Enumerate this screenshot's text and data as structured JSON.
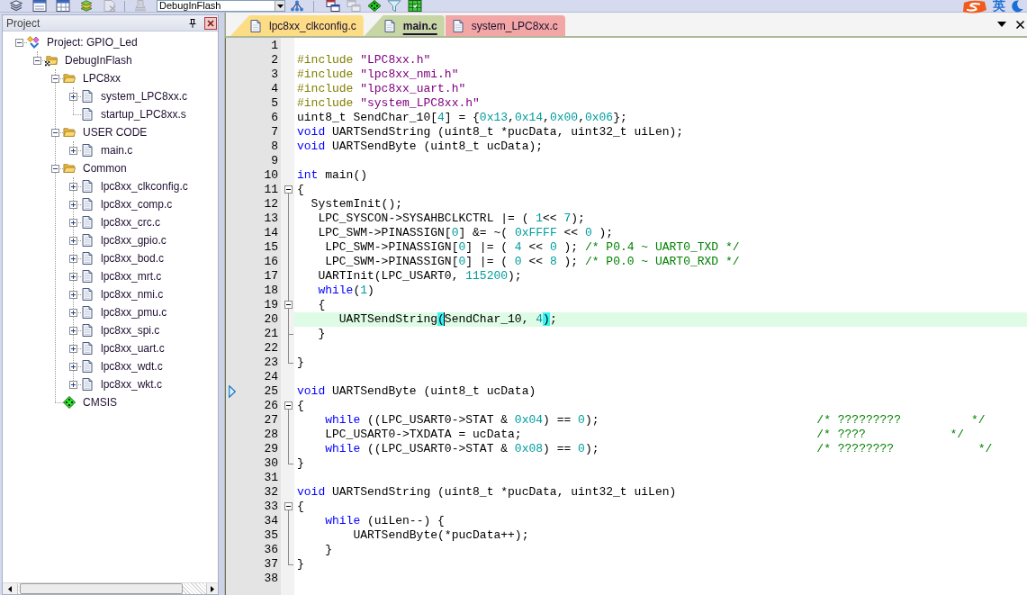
{
  "toolbar": {
    "items": [
      {
        "kind": "button",
        "disabled": false
      },
      {
        "kind": "button",
        "disabled": false
      },
      {
        "kind": "button",
        "disabled": false
      },
      {
        "kind": "button",
        "disabled": false
      },
      {
        "kind": "button",
        "disabled": true
      },
      {
        "kind": "separator"
      },
      {
        "kind": "button",
        "disabled": true
      },
      {
        "kind": "select",
        "value": "DebugInFlash"
      },
      {
        "kind": "button",
        "disabled": false
      },
      {
        "kind": "separator"
      },
      {
        "kind": "button",
        "disabled": false
      },
      {
        "kind": "button",
        "disabled": true
      },
      {
        "kind": "button",
        "disabled": false
      },
      {
        "kind": "button",
        "disabled": false
      },
      {
        "kind": "button",
        "disabled": false
      }
    ]
  },
  "input_method": {
    "mode": "英"
  },
  "project_panel": {
    "title": "Project",
    "tree": [
      {
        "label": "Project: GPIO_Led",
        "kind": "project",
        "expanded": true,
        "children": [
          {
            "label": "DebugInFlash",
            "kind": "target",
            "expanded": true,
            "children": [
              {
                "label": "LPC8xx",
                "kind": "folder",
                "expanded": true,
                "children": [
                  {
                    "label": "system_LPC8xx.c",
                    "kind": "file",
                    "expanded": false
                  },
                  {
                    "label": "startup_LPC8xx.s",
                    "kind": "file"
                  }
                ]
              },
              {
                "label": "USER CODE",
                "kind": "folder",
                "expanded": true,
                "children": [
                  {
                    "label": "main.c",
                    "kind": "file",
                    "expanded": false
                  }
                ]
              },
              {
                "label": "Common",
                "kind": "folder",
                "expanded": true,
                "children": [
                  {
                    "label": "lpc8xx_clkconfig.c",
                    "kind": "file",
                    "expanded": false
                  },
                  {
                    "label": "lpc8xx_comp.c",
                    "kind": "file",
                    "expanded": false
                  },
                  {
                    "label": "lpc8xx_crc.c",
                    "kind": "file",
                    "expanded": false
                  },
                  {
                    "label": "lpc8xx_gpio.c",
                    "kind": "file",
                    "expanded": false
                  },
                  {
                    "label": "lpc8xx_bod.c",
                    "kind": "file",
                    "expanded": false
                  },
                  {
                    "label": "lpc8xx_mrt.c",
                    "kind": "file",
                    "expanded": false
                  },
                  {
                    "label": "lpc8xx_nmi.c",
                    "kind": "file",
                    "expanded": false
                  },
                  {
                    "label": "lpc8xx_pmu.c",
                    "kind": "file",
                    "expanded": false
                  },
                  {
                    "label": "lpc8xx_spi.c",
                    "kind": "file",
                    "expanded": false
                  },
                  {
                    "label": "lpc8xx_uart.c",
                    "kind": "file",
                    "expanded": false
                  },
                  {
                    "label": "lpc8xx_wdt.c",
                    "kind": "file",
                    "expanded": false
                  },
                  {
                    "label": "lpc8xx_wkt.c",
                    "kind": "file",
                    "expanded": false
                  }
                ]
              },
              {
                "label": "CMSIS",
                "kind": "component"
              }
            ]
          }
        ]
      }
    ]
  },
  "editor": {
    "tabs": [
      {
        "label": "lpc8xx_clkconfig.c",
        "selected": false,
        "color": "#fcdc84"
      },
      {
        "label": "main.c",
        "selected": true,
        "color": "#c8d6a6"
      },
      {
        "label": "system_LPC8xx.c",
        "selected": false,
        "color": "#f2a6a6"
      }
    ],
    "lines": [
      {
        "number": "1",
        "fold_open": false,
        "fold_close": false,
        "current": false,
        "marker": false
      },
      {
        "number": "2",
        "fold_open": false,
        "fold_close": false,
        "current": false,
        "marker": false,
        "tokens": [
          {
            "kind": "preprocessor",
            "text": "#include "
          },
          {
            "kind": "string",
            "text": "\"LPC8xx.h\""
          }
        ]
      },
      {
        "number": "3",
        "fold_open": false,
        "fold_close": false,
        "current": false,
        "marker": false,
        "tokens": [
          {
            "kind": "preprocessor",
            "text": "#include "
          },
          {
            "kind": "string",
            "text": "\"lpc8xx_nmi.h\""
          }
        ]
      },
      {
        "number": "4",
        "fold_open": false,
        "fold_close": false,
        "current": false,
        "marker": false,
        "tokens": [
          {
            "kind": "preprocessor",
            "text": "#include "
          },
          {
            "kind": "string",
            "text": "\"lpc8xx_uart.h\""
          }
        ]
      },
      {
        "number": "5",
        "fold_open": false,
        "fold_close": false,
        "current": false,
        "marker": false,
        "tokens": [
          {
            "kind": "preprocessor",
            "text": "#include "
          },
          {
            "kind": "string",
            "text": "\"system_LPC8xx.h\""
          }
        ]
      },
      {
        "number": "6",
        "fold_open": false,
        "fold_close": false,
        "current": false,
        "marker": false,
        "tokens": [
          {
            "kind": "plain",
            "text": "uint8_t SendChar_10["
          },
          {
            "kind": "number",
            "text": "4"
          },
          {
            "kind": "plain",
            "text": "] = {"
          },
          {
            "kind": "number",
            "text": "0x13"
          },
          {
            "kind": "plain",
            "text": ","
          },
          {
            "kind": "number",
            "text": "0x14"
          },
          {
            "kind": "plain",
            "text": ","
          },
          {
            "kind": "number",
            "text": "0x00"
          },
          {
            "kind": "plain",
            "text": ","
          },
          {
            "kind": "number",
            "text": "0x06"
          },
          {
            "kind": "plain",
            "text": "};"
          }
        ]
      },
      {
        "number": "7",
        "fold_open": false,
        "fold_close": false,
        "current": false,
        "marker": false,
        "tokens": [
          {
            "kind": "keyword",
            "text": "void"
          },
          {
            "kind": "plain",
            "text": " UARTSendString (uint8_t *pucData, uint32_t uiLen);"
          }
        ]
      },
      {
        "number": "8",
        "fold_open": false,
        "fold_close": false,
        "current": false,
        "marker": false,
        "tokens": [
          {
            "kind": "keyword",
            "text": "void"
          },
          {
            "kind": "plain",
            "text": " UARTSendByte (uint8_t ucData);"
          }
        ]
      },
      {
        "number": "9",
        "fold_open": false,
        "fold_close": false,
        "current": false,
        "marker": false
      },
      {
        "number": "10",
        "fold_open": false,
        "fold_close": false,
        "current": false,
        "marker": false,
        "tokens": [
          {
            "kind": "keyword",
            "text": "int"
          },
          {
            "kind": "plain",
            "text": " main()"
          }
        ]
      },
      {
        "number": "11",
        "fold_open": true,
        "fold_close": false,
        "current": false,
        "marker": false,
        "tokens": [
          {
            "kind": "plain",
            "text": "{"
          }
        ]
      },
      {
        "number": "12",
        "fold_open": false,
        "fold_close": false,
        "current": false,
        "marker": false,
        "tokens": [
          {
            "kind": "plain",
            "text": "  SystemInit();"
          }
        ]
      },
      {
        "number": "13",
        "fold_open": false,
        "fold_close": false,
        "current": false,
        "marker": false,
        "tokens": [
          {
            "kind": "plain",
            "text": "   LPC_SYSCON->SYSAHBCLKCTRL |= ( "
          },
          {
            "kind": "number",
            "text": "1"
          },
          {
            "kind": "plain",
            "text": "<< "
          },
          {
            "kind": "number",
            "text": "7"
          },
          {
            "kind": "plain",
            "text": ");"
          }
        ]
      },
      {
        "number": "14",
        "fold_open": false,
        "fold_close": false,
        "current": false,
        "marker": false,
        "tokens": [
          {
            "kind": "plain",
            "text": "   LPC_SWM->PINASSIGN["
          },
          {
            "kind": "number",
            "text": "0"
          },
          {
            "kind": "plain",
            "text": "] &= ~( "
          },
          {
            "kind": "number",
            "text": "0xFFFF"
          },
          {
            "kind": "plain",
            "text": " << "
          },
          {
            "kind": "number",
            "text": "0"
          },
          {
            "kind": "plain",
            "text": " );"
          }
        ]
      },
      {
        "number": "15",
        "fold_open": false,
        "fold_close": false,
        "current": false,
        "marker": false,
        "tokens": [
          {
            "kind": "plain",
            "text": "    LPC_SWM->PINASSIGN["
          },
          {
            "kind": "number",
            "text": "0"
          },
          {
            "kind": "plain",
            "text": "] |= ( "
          },
          {
            "kind": "number",
            "text": "4"
          },
          {
            "kind": "plain",
            "text": " << "
          },
          {
            "kind": "number",
            "text": "0"
          },
          {
            "kind": "plain",
            "text": " ); "
          },
          {
            "kind": "comment",
            "text": "/* P0.4 ~ UART0_TXD */"
          }
        ]
      },
      {
        "number": "16",
        "fold_open": false,
        "fold_close": false,
        "current": false,
        "marker": false,
        "tokens": [
          {
            "kind": "plain",
            "text": "    LPC_SWM->PINASSIGN["
          },
          {
            "kind": "number",
            "text": "0"
          },
          {
            "kind": "plain",
            "text": "] |= ( "
          },
          {
            "kind": "number",
            "text": "0"
          },
          {
            "kind": "plain",
            "text": " << "
          },
          {
            "kind": "number",
            "text": "8"
          },
          {
            "kind": "plain",
            "text": " ); "
          },
          {
            "kind": "comment",
            "text": "/* P0.0 ~ UART0_RXD */"
          }
        ]
      },
      {
        "number": "17",
        "fold_open": false,
        "fold_close": false,
        "current": false,
        "marker": false,
        "tokens": [
          {
            "kind": "plain",
            "text": "   UARTInit(LPC_USART0, "
          },
          {
            "kind": "number",
            "text": "115200"
          },
          {
            "kind": "plain",
            "text": ");"
          }
        ]
      },
      {
        "number": "18",
        "fold_open": false,
        "fold_close": false,
        "current": false,
        "marker": false,
        "tokens": [
          {
            "kind": "keyword",
            "text": "   while"
          },
          {
            "kind": "plain",
            "text": "("
          },
          {
            "kind": "number",
            "text": "1"
          },
          {
            "kind": "plain",
            "text": ")"
          }
        ]
      },
      {
        "number": "19",
        "fold_open": true,
        "fold_close": false,
        "current": false,
        "marker": false,
        "tokens": [
          {
            "kind": "plain",
            "text": "   {"
          }
        ]
      },
      {
        "number": "20",
        "fold_open": false,
        "fold_close": false,
        "current": true,
        "marker": false,
        "tokens": [
          {
            "kind": "plain",
            "text": "      UARTSendString"
          },
          {
            "kind": "brace_caret",
            "text": "("
          },
          {
            "kind": "plain",
            "text": "SendChar_10, "
          },
          {
            "kind": "number",
            "text": "4"
          },
          {
            "kind": "brace",
            "text": ")"
          },
          {
            "kind": "plain",
            "text": ";"
          }
        ]
      },
      {
        "number": "21",
        "fold_open": false,
        "fold_close": true,
        "current": false,
        "marker": false,
        "tokens": [
          {
            "kind": "plain",
            "text": "   }"
          }
        ]
      },
      {
        "number": "22",
        "fold_open": false,
        "fold_close": false,
        "current": false,
        "marker": false
      },
      {
        "number": "23",
        "fold_open": false,
        "fold_close": true,
        "current": false,
        "marker": false,
        "tokens": [
          {
            "kind": "plain",
            "text": "}"
          }
        ]
      },
      {
        "number": "24",
        "fold_open": false,
        "fold_close": false,
        "current": false,
        "marker": false
      },
      {
        "number": "25",
        "fold_open": false,
        "fold_close": false,
        "current": false,
        "marker": true,
        "tokens": [
          {
            "kind": "keyword",
            "text": "void"
          },
          {
            "kind": "plain",
            "text": " UARTSendByte (uint8_t ucData)"
          }
        ]
      },
      {
        "number": "26",
        "fold_open": true,
        "fold_close": false,
        "current": false,
        "marker": false,
        "tokens": [
          {
            "kind": "plain",
            "text": "{"
          }
        ]
      },
      {
        "number": "27",
        "fold_open": false,
        "fold_close": false,
        "current": false,
        "marker": false,
        "tokens": [
          {
            "kind": "keyword",
            "text": "    while"
          },
          {
            "kind": "plain",
            "text": " ((LPC_USART0->STAT & "
          },
          {
            "kind": "number",
            "text": "0x04"
          },
          {
            "kind": "plain",
            "text": ") == "
          },
          {
            "kind": "number",
            "text": "0"
          },
          {
            "kind": "plain",
            "text": ");                               "
          },
          {
            "kind": "comment",
            "text": "/* ?????????          */"
          }
        ]
      },
      {
        "number": "28",
        "fold_open": false,
        "fold_close": false,
        "current": false,
        "marker": false,
        "tokens": [
          {
            "kind": "plain",
            "text": "    LPC_USART0->TXDATA = ucData;                                          "
          },
          {
            "kind": "comment",
            "text": "/* ????            */"
          }
        ]
      },
      {
        "number": "29",
        "fold_open": false,
        "fold_close": false,
        "current": false,
        "marker": false,
        "tokens": [
          {
            "kind": "keyword",
            "text": "    while"
          },
          {
            "kind": "plain",
            "text": " ((LPC_USART0->STAT & "
          },
          {
            "kind": "number",
            "text": "0x08"
          },
          {
            "kind": "plain",
            "text": ") == "
          },
          {
            "kind": "number",
            "text": "0"
          },
          {
            "kind": "plain",
            "text": ");                               "
          },
          {
            "kind": "comment",
            "text": "/* ????????            */"
          }
        ]
      },
      {
        "number": "30",
        "fold_open": false,
        "fold_close": true,
        "current": false,
        "marker": false,
        "tokens": [
          {
            "kind": "plain",
            "text": "}"
          }
        ]
      },
      {
        "number": "31",
        "fold_open": false,
        "fold_close": false,
        "current": false,
        "marker": false
      },
      {
        "number": "32",
        "fold_open": false,
        "fold_close": false,
        "current": false,
        "marker": false,
        "tokens": [
          {
            "kind": "keyword",
            "text": "void"
          },
          {
            "kind": "plain",
            "text": " UARTSendString (uint8_t *pucData, uint32_t uiLen)"
          }
        ]
      },
      {
        "number": "33",
        "fold_open": true,
        "fold_close": false,
        "current": false,
        "marker": false,
        "tokens": [
          {
            "kind": "plain",
            "text": "{"
          }
        ]
      },
      {
        "number": "34",
        "fold_open": false,
        "fold_close": false,
        "current": false,
        "marker": false,
        "tokens": [
          {
            "kind": "keyword",
            "text": "    while"
          },
          {
            "kind": "plain",
            "text": " (uiLen--) {"
          }
        ]
      },
      {
        "number": "35",
        "fold_open": false,
        "fold_close": false,
        "current": false,
        "marker": false,
        "tokens": [
          {
            "kind": "plain",
            "text": "        UARTSendByte(*pucData++);"
          }
        ]
      },
      {
        "number": "36",
        "fold_open": false,
        "fold_close": false,
        "current": false,
        "marker": false,
        "tokens": [
          {
            "kind": "plain",
            "text": "    }"
          }
        ]
      },
      {
        "number": "37",
        "fold_open": false,
        "fold_close": true,
        "current": false,
        "marker": false,
        "tokens": [
          {
            "kind": "plain",
            "text": "}"
          }
        ]
      },
      {
        "number": "38",
        "fold_open": false,
        "fold_close": false,
        "current": false,
        "marker": false
      }
    ]
  }
}
